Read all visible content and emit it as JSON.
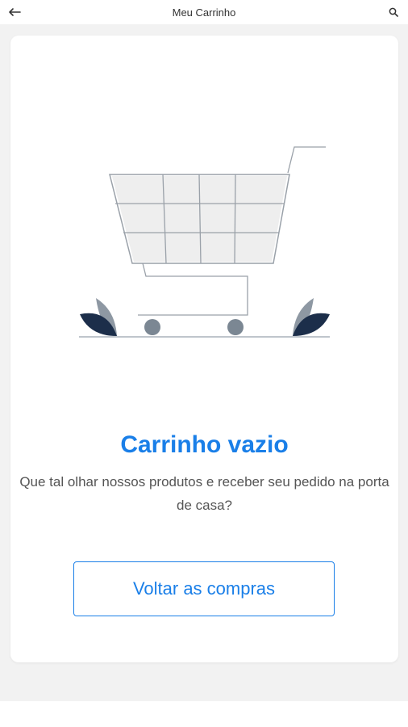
{
  "header": {
    "title": "Meu Carrinho",
    "back_icon": "arrow-left-icon",
    "search_icon": "search-icon"
  },
  "empty_state": {
    "title": "Carrinho vazio",
    "message": "Que tal olhar nossos produtos e receber seu pedido na porta de casa?",
    "button_label": "Voltar as compras",
    "illustration_icon": "shopping-cart-icon"
  },
  "colors": {
    "accent": "#1a7fe8",
    "background": "#f2f2f2",
    "card": "#ffffff",
    "text_muted": "#555555",
    "navy": "#1c2e4a",
    "gray_leaf": "#8e98a3"
  }
}
